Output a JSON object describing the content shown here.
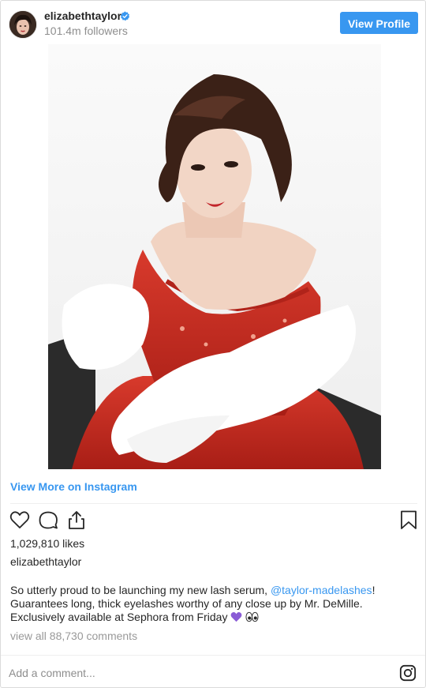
{
  "header": {
    "username": "elizabethtaylor",
    "followers": "101.4m followers",
    "view_profile_label": "View Profile"
  },
  "post": {
    "view_more_label": "View More on Instagram",
    "likes": "1,029,810 likes",
    "owner": "elizabethtaylor",
    "caption_before_mention": "So utterly proud to be launching my new lash serum, ",
    "mention": "@taylor-madelashes",
    "caption_after_mention": "! Guarantees long, thick eyelashes worthy of any close up by Mr. DeMille. Exclusively available at Sephora from Friday",
    "view_all_comments": "view all 88,730 comments"
  },
  "comment_box": {
    "placeholder": "Add a comment..."
  },
  "colors": {
    "accent": "#3897f0",
    "muted_text": "#8e8e8e",
    "border": "#dbdbdb",
    "purple_heart": "#8a5cd6"
  },
  "icons": {
    "verified": "verified-badge-icon",
    "like": "heart-outline-icon",
    "comment": "speech-bubble-icon",
    "share": "share-upload-icon",
    "save": "bookmark-icon",
    "emoji_heart": "purple-heart-icon",
    "emoji_eyes": "eyes-icon",
    "instagram": "instagram-logo-icon"
  }
}
